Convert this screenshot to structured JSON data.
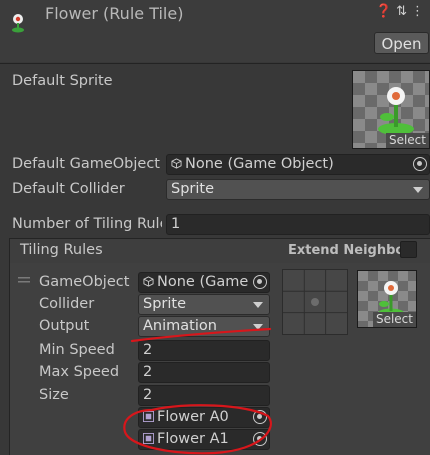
{
  "header": {
    "title": "Flower (Rule Tile)",
    "open_label": "Open"
  },
  "defaults": {
    "sprite_label": "Default Sprite",
    "gameobject_label": "Default GameObject",
    "gameobject_value": "None (Game Object)",
    "collider_label": "Default Collider",
    "collider_value": "Sprite",
    "select_label": "Select"
  },
  "tiling": {
    "count_label": "Number of Tiling Rule",
    "count_value": "1",
    "section_title": "Tiling Rules",
    "extend_neighbor_label": "Extend Neighbor"
  },
  "rule": {
    "gameobject_label": "GameObject",
    "gameobject_value": "None (Game",
    "collider_label": "Collider",
    "collider_value": "Sprite",
    "output_label": "Output",
    "output_value": "Animation",
    "min_speed_label": "Min Speed",
    "min_speed_value": "2",
    "max_speed_label": "Max Speed",
    "max_speed_value": "2",
    "size_label": "Size",
    "size_value": "2",
    "frames": [
      "Flower A0",
      "Flower A1"
    ],
    "select_label": "Select"
  },
  "colors": {
    "annotation_red": "#d8161b",
    "background": "#383838"
  }
}
